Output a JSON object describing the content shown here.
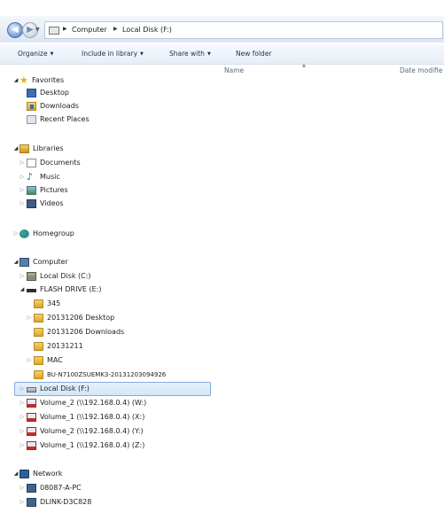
{
  "address": {
    "crumbs": [
      "Computer",
      "Local Disk (F:)"
    ]
  },
  "commands": {
    "organize": "Organize",
    "include": "Include in library",
    "share": "Share with",
    "new_folder": "New folder"
  },
  "columns": {
    "name": "Name",
    "date_modified": "Date modifie"
  },
  "tree": {
    "favorites": "Favorites",
    "desktop": "Desktop",
    "downloads": "Downloads",
    "recent": "Recent Places",
    "libraries": "Libraries",
    "documents": "Documents",
    "music": "Music",
    "pictures": "Pictures",
    "videos": "Videos",
    "homegroup": "Homegroup",
    "computer": "Computer",
    "local_c": "Local Disk (C:)",
    "flash": "FLASH DRIVE (E:)",
    "f345": "345",
    "f_desktop": "20131206 Desktop",
    "f_downloads": "20131206 Downloads",
    "f_1211": "20131211",
    "f_mac": "MAC",
    "f_bu": "BU-N7100ZSUEMK3-20131203094926",
    "local_f": "Local Disk (F:)",
    "vol_w": "Volume_2 (\\\\192.168.0.4) (W:)",
    "vol_x": "Volume_1 (\\\\192.168.0.4) (X:)",
    "vol_y": "Volume_2 (\\\\192.168.0.4) (Y:)",
    "vol_z": "Volume_1 (\\\\192.168.0.4) (Z:)",
    "network": "Network",
    "pc1": "08087-A-PC",
    "pc2": "DLINK-D3C828"
  }
}
